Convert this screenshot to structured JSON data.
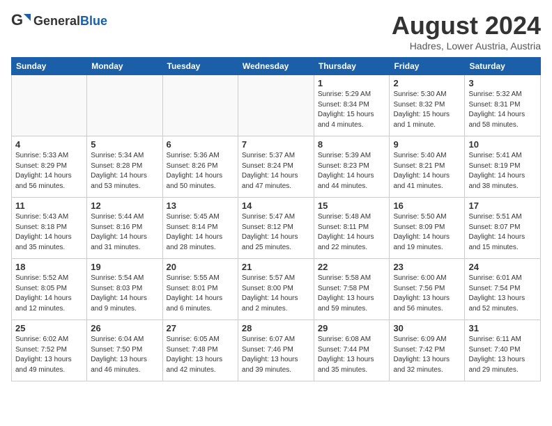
{
  "header": {
    "logo_general": "General",
    "logo_blue": "Blue",
    "title": "August 2024",
    "location": "Hadres, Lower Austria, Austria"
  },
  "weekdays": [
    "Sunday",
    "Monday",
    "Tuesday",
    "Wednesday",
    "Thursday",
    "Friday",
    "Saturday"
  ],
  "weeks": [
    [
      {
        "day": "",
        "info": ""
      },
      {
        "day": "",
        "info": ""
      },
      {
        "day": "",
        "info": ""
      },
      {
        "day": "",
        "info": ""
      },
      {
        "day": "1",
        "info": "Sunrise: 5:29 AM\nSunset: 8:34 PM\nDaylight: 15 hours\nand 4 minutes."
      },
      {
        "day": "2",
        "info": "Sunrise: 5:30 AM\nSunset: 8:32 PM\nDaylight: 15 hours\nand 1 minute."
      },
      {
        "day": "3",
        "info": "Sunrise: 5:32 AM\nSunset: 8:31 PM\nDaylight: 14 hours\nand 58 minutes."
      }
    ],
    [
      {
        "day": "4",
        "info": "Sunrise: 5:33 AM\nSunset: 8:29 PM\nDaylight: 14 hours\nand 56 minutes."
      },
      {
        "day": "5",
        "info": "Sunrise: 5:34 AM\nSunset: 8:28 PM\nDaylight: 14 hours\nand 53 minutes."
      },
      {
        "day": "6",
        "info": "Sunrise: 5:36 AM\nSunset: 8:26 PM\nDaylight: 14 hours\nand 50 minutes."
      },
      {
        "day": "7",
        "info": "Sunrise: 5:37 AM\nSunset: 8:24 PM\nDaylight: 14 hours\nand 47 minutes."
      },
      {
        "day": "8",
        "info": "Sunrise: 5:39 AM\nSunset: 8:23 PM\nDaylight: 14 hours\nand 44 minutes."
      },
      {
        "day": "9",
        "info": "Sunrise: 5:40 AM\nSunset: 8:21 PM\nDaylight: 14 hours\nand 41 minutes."
      },
      {
        "day": "10",
        "info": "Sunrise: 5:41 AM\nSunset: 8:19 PM\nDaylight: 14 hours\nand 38 minutes."
      }
    ],
    [
      {
        "day": "11",
        "info": "Sunrise: 5:43 AM\nSunset: 8:18 PM\nDaylight: 14 hours\nand 35 minutes."
      },
      {
        "day": "12",
        "info": "Sunrise: 5:44 AM\nSunset: 8:16 PM\nDaylight: 14 hours\nand 31 minutes."
      },
      {
        "day": "13",
        "info": "Sunrise: 5:45 AM\nSunset: 8:14 PM\nDaylight: 14 hours\nand 28 minutes."
      },
      {
        "day": "14",
        "info": "Sunrise: 5:47 AM\nSunset: 8:12 PM\nDaylight: 14 hours\nand 25 minutes."
      },
      {
        "day": "15",
        "info": "Sunrise: 5:48 AM\nSunset: 8:11 PM\nDaylight: 14 hours\nand 22 minutes."
      },
      {
        "day": "16",
        "info": "Sunrise: 5:50 AM\nSunset: 8:09 PM\nDaylight: 14 hours\nand 19 minutes."
      },
      {
        "day": "17",
        "info": "Sunrise: 5:51 AM\nSunset: 8:07 PM\nDaylight: 14 hours\nand 15 minutes."
      }
    ],
    [
      {
        "day": "18",
        "info": "Sunrise: 5:52 AM\nSunset: 8:05 PM\nDaylight: 14 hours\nand 12 minutes."
      },
      {
        "day": "19",
        "info": "Sunrise: 5:54 AM\nSunset: 8:03 PM\nDaylight: 14 hours\nand 9 minutes."
      },
      {
        "day": "20",
        "info": "Sunrise: 5:55 AM\nSunset: 8:01 PM\nDaylight: 14 hours\nand 6 minutes."
      },
      {
        "day": "21",
        "info": "Sunrise: 5:57 AM\nSunset: 8:00 PM\nDaylight: 14 hours\nand 2 minutes."
      },
      {
        "day": "22",
        "info": "Sunrise: 5:58 AM\nSunset: 7:58 PM\nDaylight: 13 hours\nand 59 minutes."
      },
      {
        "day": "23",
        "info": "Sunrise: 6:00 AM\nSunset: 7:56 PM\nDaylight: 13 hours\nand 56 minutes."
      },
      {
        "day": "24",
        "info": "Sunrise: 6:01 AM\nSunset: 7:54 PM\nDaylight: 13 hours\nand 52 minutes."
      }
    ],
    [
      {
        "day": "25",
        "info": "Sunrise: 6:02 AM\nSunset: 7:52 PM\nDaylight: 13 hours\nand 49 minutes."
      },
      {
        "day": "26",
        "info": "Sunrise: 6:04 AM\nSunset: 7:50 PM\nDaylight: 13 hours\nand 46 minutes."
      },
      {
        "day": "27",
        "info": "Sunrise: 6:05 AM\nSunset: 7:48 PM\nDaylight: 13 hours\nand 42 minutes."
      },
      {
        "day": "28",
        "info": "Sunrise: 6:07 AM\nSunset: 7:46 PM\nDaylight: 13 hours\nand 39 minutes."
      },
      {
        "day": "29",
        "info": "Sunrise: 6:08 AM\nSunset: 7:44 PM\nDaylight: 13 hours\nand 35 minutes."
      },
      {
        "day": "30",
        "info": "Sunrise: 6:09 AM\nSunset: 7:42 PM\nDaylight: 13 hours\nand 32 minutes."
      },
      {
        "day": "31",
        "info": "Sunrise: 6:11 AM\nSunset: 7:40 PM\nDaylight: 13 hours\nand 29 minutes."
      }
    ]
  ]
}
